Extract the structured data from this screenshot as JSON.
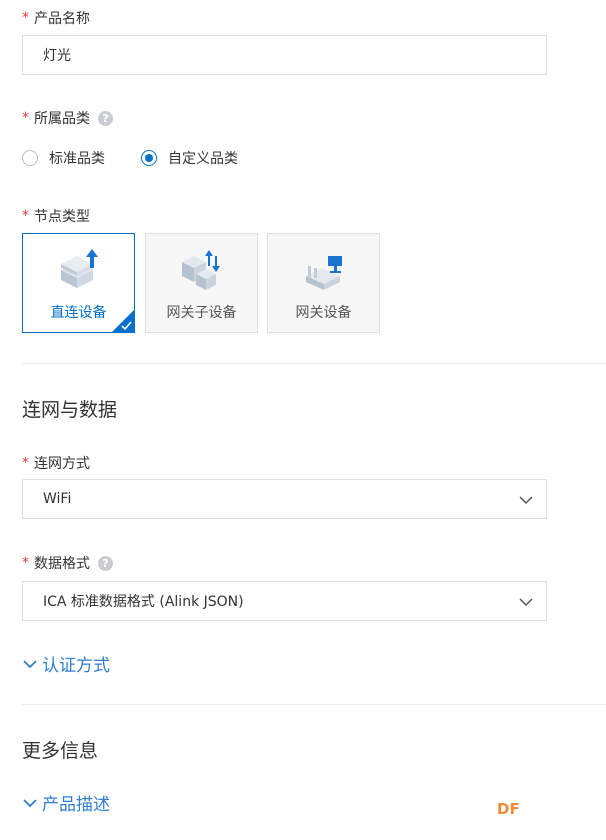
{
  "product_name": {
    "label": "产品名称",
    "value": "灯光"
  },
  "category": {
    "label": "所属品类",
    "options": [
      {
        "label": "标准品类",
        "checked": false
      },
      {
        "label": "自定义品类",
        "checked": true
      }
    ]
  },
  "node_type": {
    "label": "节点类型",
    "cards": [
      {
        "label": "直连设备",
        "selected": true,
        "icon": "direct-device-icon"
      },
      {
        "label": "网关子设备",
        "selected": false,
        "icon": "gateway-subdevice-icon"
      },
      {
        "label": "网关设备",
        "selected": false,
        "icon": "gateway-device-icon"
      }
    ]
  },
  "network_section": {
    "title": "连网与数据",
    "connect_label": "连网方式",
    "connect_value": "WiFi",
    "data_format_label": "数据格式",
    "data_format_value": "ICA 标准数据格式 (Alink JSON)",
    "auth_expander": "认证方式"
  },
  "more_section": {
    "title": "更多信息",
    "desc_expander": "产品描述"
  },
  "help_glyph": "?",
  "required_mark": "*",
  "watermark": "DF",
  "colors": {
    "accent": "#0070cc",
    "link": "#2f7cd3",
    "required": "#e0393e"
  }
}
